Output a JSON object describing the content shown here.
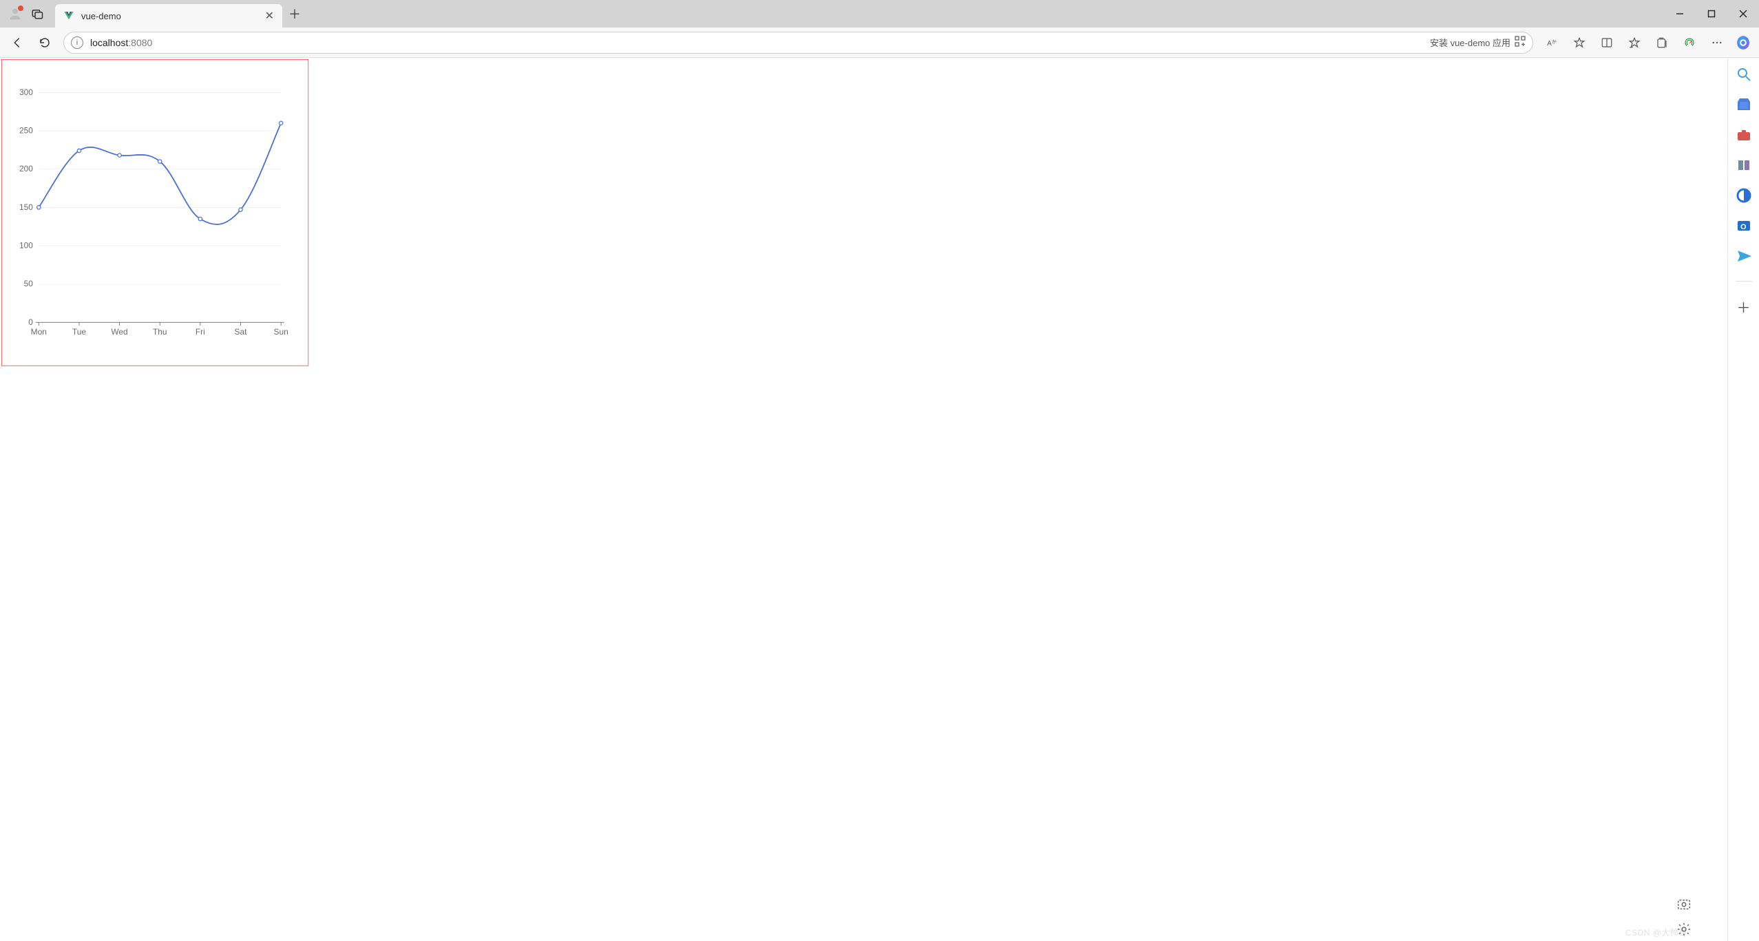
{
  "browser": {
    "tab_title": "vue-demo",
    "url_host": "localhost",
    "url_port": ":8080",
    "install_text": "安装 vue-demo 应用"
  },
  "chart_data": {
    "type": "line",
    "categories": [
      "Mon",
      "Tue",
      "Wed",
      "Thu",
      "Fri",
      "Sat",
      "Sun"
    ],
    "values": [
      150,
      224,
      218,
      210,
      135,
      147,
      260
    ],
    "y_ticks": [
      0,
      50,
      100,
      150,
      200,
      250,
      300
    ],
    "xlabel": "",
    "ylabel": "",
    "title": "",
    "ylim": [
      0,
      300
    ],
    "smooth": true
  },
  "watermark": "CSDN @大帅哥"
}
